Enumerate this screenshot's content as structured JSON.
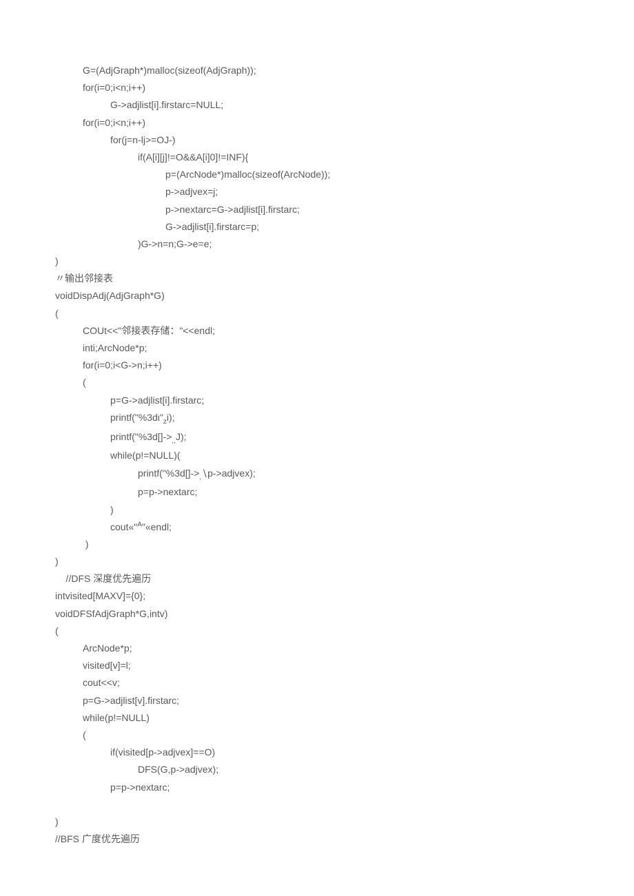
{
  "lines": [
    {
      "cls": "i1",
      "text": "G=(AdjGraph*)malloc(sizeof(AdjGraph));"
    },
    {
      "cls": "i1",
      "text": "for(i=0;i<n;i++)"
    },
    {
      "cls": "i2",
      "text": "G->adjlist[i].firstarc=NULL;"
    },
    {
      "cls": "i1",
      "text": "for(i=0;i<n;i++)"
    },
    {
      "cls": "i2",
      "text": "for(j=n-lj>=OJ-)"
    },
    {
      "cls": "i3",
      "text": "if(A[i][j]!=O&&A[i]0]!=INF){"
    },
    {
      "cls": "i4",
      "text": "p=(ArcNode*)malloc(sizeof(ArcNode));"
    },
    {
      "cls": "i4",
      "text": "p->adjvex=j;"
    },
    {
      "cls": "i4",
      "text": "p->nextarc=G->adjlist[i].firstarc;"
    },
    {
      "cls": "i4",
      "text": "G->adjlist[i].firstarc=p;"
    },
    {
      "cls": "i3",
      "text": ")G->n=n;G->e=e;"
    },
    {
      "cls": "",
      "text": ")"
    },
    {
      "cls": "",
      "text": "〃输出邻接表"
    },
    {
      "cls": "",
      "text": "voidDispAdj(AdjGraph*G)"
    },
    {
      "cls": "",
      "text": "("
    },
    {
      "cls": "i1",
      "text": "COUt<<\"邻接表存储：\"<<endl;"
    },
    {
      "cls": "i1",
      "text": "inti;ArcNode*p;"
    },
    {
      "cls": "i1",
      "text": "for(i=0;i<G->n;i++)"
    },
    {
      "cls": "i1",
      "text": "("
    },
    {
      "cls": "i2",
      "html": "p=G-&gt;adjlist[i].firstarc;"
    },
    {
      "cls": "i2",
      "html": "printf(\"%3dι\"<span class=\"sub\">z</span>i);"
    },
    {
      "cls": "i2",
      "html": "printf(\"%3d[]-&gt;<span class=\"sub\">,,</span>J);"
    },
    {
      "cls": "i2",
      "text": "while(p!=NULL)("
    },
    {
      "cls": "i3",
      "html": "printf(\"%3d[]-&gt;<span class=\"sub\">,</span>∖p-&gt;adjvex);"
    },
    {
      "cls": "i3",
      "text": "p=p->nextarc;"
    },
    {
      "cls": "i2",
      "text": ")"
    },
    {
      "cls": "i2",
      "html": "cout«\"<span class=\"sup\">A</span>\"«endl;"
    },
    {
      "cls": "i1",
      "text": " )"
    },
    {
      "cls": "",
      "text": ")"
    },
    {
      "cls": "",
      "text": "    //DFS 深度优先遍历"
    },
    {
      "cls": "",
      "text": "intvisited[MAXV]={0};"
    },
    {
      "cls": "",
      "text": "voidDFSfAdjGraph*G,intv)"
    },
    {
      "cls": "",
      "text": "("
    },
    {
      "cls": "i1",
      "text": "ArcNode*p;"
    },
    {
      "cls": "i1",
      "text": "visited[v]=l;"
    },
    {
      "cls": "i1",
      "text": "cout<<v;"
    },
    {
      "cls": "i1",
      "text": "p=G->adjlist[v].firstarc;"
    },
    {
      "cls": "i1",
      "text": "while(p!=NULL)"
    },
    {
      "cls": "i1",
      "text": "("
    },
    {
      "cls": "i2",
      "text": "if(visited[p->adjvex]==O)"
    },
    {
      "cls": "i3",
      "text": "DFS(G,p->adjvex);"
    },
    {
      "cls": "i2",
      "text": "p=p->nextarc;"
    },
    {
      "cls": "",
      "text": ""
    },
    {
      "cls": "",
      "text": ")"
    },
    {
      "cls": "",
      "text": "//BFS 广度优先遍历"
    }
  ]
}
